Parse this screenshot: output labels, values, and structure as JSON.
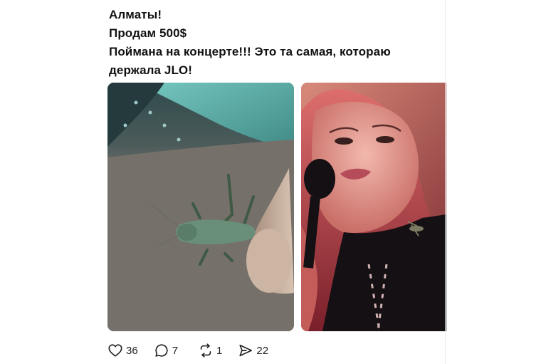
{
  "post": {
    "lines": [
      "Алматы!",
      "Продам  500$",
      "Поймана на концерте!!! Это та самая, котораю",
      "держала JLO!"
    ]
  },
  "media": [
    {
      "icon": "grasshopper-photo"
    },
    {
      "icon": "singer-photo"
    }
  ],
  "actions": {
    "likes": "36",
    "replies": "7",
    "reposts": "1",
    "shares": "22"
  }
}
